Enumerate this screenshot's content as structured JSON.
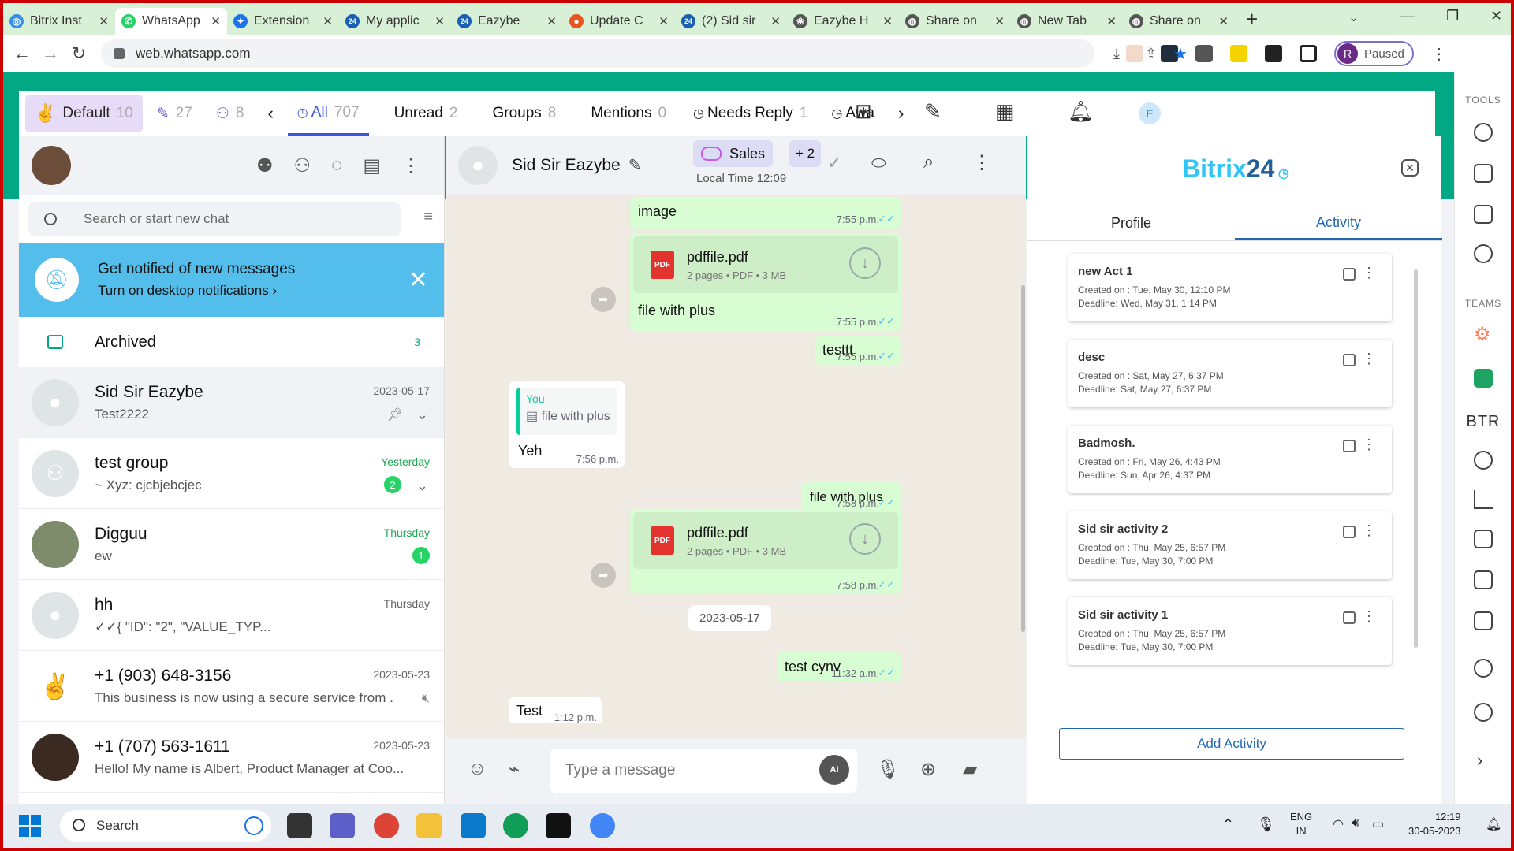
{
  "browser": {
    "tabs": [
      {
        "label": "Bitrix Inst",
        "color": "#3a8ee6",
        "glyph": "◎"
      },
      {
        "label": "WhatsApp",
        "color": "#25d366",
        "glyph": "✆"
      },
      {
        "label": "Extension",
        "color": "#1a73e8",
        "glyph": "✦"
      },
      {
        "label": "My applic",
        "color": "#1a5fb4",
        "glyph": "24"
      },
      {
        "label": "Eazybe",
        "color": "#1a5fb4",
        "glyph": "24"
      },
      {
        "label": "Update C",
        "color": "#e8531f",
        "glyph": "●"
      },
      {
        "label": "(2) Sid sir",
        "color": "#1a5fb4",
        "glyph": "24"
      },
      {
        "label": "Eazybe H",
        "color": "#555555",
        "glyph": "❀"
      },
      {
        "label": "Share on",
        "color": "#555555",
        "glyph": "◍"
      },
      {
        "label": "New Tab",
        "color": "#555555",
        "glyph": "◍"
      },
      {
        "label": "Share on",
        "color": "#555555",
        "glyph": "◍"
      }
    ],
    "url": "web.whatsapp.com",
    "profile_initial": "R",
    "profile_status": "Paused"
  },
  "filterbar": {
    "default_label": "Default",
    "default_count": "10",
    "drafts_count": "27",
    "contacts_count": "8",
    "tabs": [
      {
        "label": "All",
        "count": "707"
      },
      {
        "label": "Unread",
        "count": "2"
      },
      {
        "label": "Groups",
        "count": "8"
      },
      {
        "label": "Mentions",
        "count": "0"
      },
      {
        "label": "Needs Reply",
        "count": "1"
      },
      {
        "label": "Awa",
        "count": ""
      }
    ],
    "user_initial": "E"
  },
  "chatlist": {
    "search_placeholder": "Search or start new chat",
    "notif_title": "Get notified of new messages",
    "notif_sub": "Turn on desktop notifications ›",
    "archived_label": "Archived",
    "archived_count": "3",
    "chats": [
      {
        "name": "Sid Sir Eazybe",
        "preview": "Test2222",
        "time": "2023-05-17",
        "badge": ""
      },
      {
        "name": "test group",
        "preview": "~ Xyz: cjcbjebcjec",
        "time": "Yesterday",
        "badge": "2"
      },
      {
        "name": "Digguu",
        "preview": "ew",
        "time": "Thursday",
        "badge": "1"
      },
      {
        "name": "hh",
        "preview": "✓✓{                    \"ID\": \"2\",                    \"VALUE_TYP...",
        "time": "Thursday",
        "badge": ""
      },
      {
        "name": "+1 (903) 648-3156",
        "preview": "This business is now using a secure service from ...",
        "time": "2023-05-23",
        "badge": ""
      },
      {
        "name": "+1 (707) 563-1611",
        "preview": "Hello! My name is Albert, Product Manager at Coo...",
        "time": "2023-05-23",
        "badge": ""
      }
    ]
  },
  "conversation": {
    "contact_name": "Sid Sir Eazybe",
    "label": "Sales",
    "label_more": "+ 2",
    "local_time": "Local Time 12:09",
    "messages": {
      "m1_text": "image",
      "m1_time": "7:55 p.m.",
      "pdf1_name": "pdffile.pdf",
      "pdf1_meta": "2 pages • PDF • 3 MB",
      "m2_text": "file with plus",
      "m2_time": "7:55 p.m.",
      "m3_text": "testtt",
      "m3_time": "7:55 p.m.",
      "reply_author": "You",
      "reply_quote": "file with plus",
      "m4_text": "Yeh",
      "m4_time": "7:56 p.m.",
      "m5_text": "file with plus",
      "m5_time": "7:58 p.m.",
      "pdf2_name": "pdffile.pdf",
      "pdf2_meta": "2 pages • PDF • 3 MB",
      "pdf2_time": "7:58 p.m.",
      "date_sep": "2023-05-17",
      "m6_text": "test cynv",
      "m6_time": "11:32 a.m.",
      "m7_text": "Test",
      "m7_time": "1:12 p.m."
    },
    "compose_placeholder": "Type a message",
    "ai_label": "AI"
  },
  "bitrix": {
    "logo_main": "Bitrix",
    "logo_num": "24",
    "tab_profile": "Profile",
    "tab_activity": "Activity",
    "activities": [
      {
        "name": "new Act 1",
        "created": "Created on : Tue, May 30, 12:10 PM",
        "deadline": "Deadline: Wed, May 31, 1:14 PM"
      },
      {
        "name": "desc",
        "created": "Created on : Sat, May 27, 6:37 PM",
        "deadline": "Deadline: Sat, May 27, 6:37 PM"
      },
      {
        "name": "Badmosh.",
        "created": "Created on : Fri, May 26, 4:43 PM",
        "deadline": "Deadline: Sun, Apr 26, 4:37 PM"
      },
      {
        "name": "Sid sir activity 2",
        "created": "Created on : Thu, May 25, 6:57 PM",
        "deadline": "Deadline: Tue, May 30, 7:00 PM"
      },
      {
        "name": "Sid sir activity 1",
        "created": "Created on : Thu, May 25, 6:57 PM",
        "deadline": "Deadline: Tue, May 30, 7:00 PM"
      }
    ],
    "add_label": "Add Activity"
  },
  "sidebar": {
    "tools_label": "TOOLS",
    "teams_label": "TEAMS",
    "btr_label": "BTR"
  },
  "taskbar": {
    "search_label": "Search",
    "lang": "ENG",
    "region": "IN",
    "time": "12:19",
    "date": "30-05-2023"
  }
}
